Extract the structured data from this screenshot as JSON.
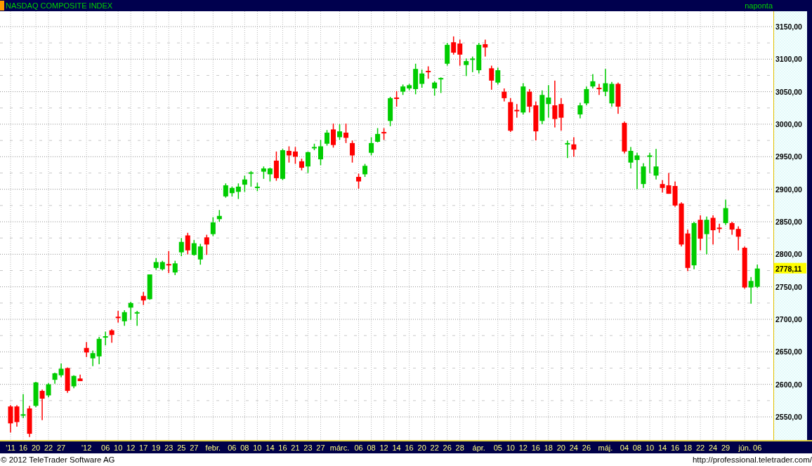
{
  "window": {
    "title": "NASDAQ COMPOSITE INDEX",
    "interval": "naponta"
  },
  "chart": {
    "last_value_label": "2778,11",
    "chart_data": {
      "type": "candlestick",
      "grid": true,
      "ylim": [
        2514.4,
        3173.7
      ],
      "yticks": [
        {
          "value": 3150,
          "label": "3150,00"
        },
        {
          "value": 3100,
          "label": "3100,00"
        },
        {
          "value": 3050,
          "label": "3050,00"
        },
        {
          "value": 3000,
          "label": "3000,00"
        },
        {
          "value": 2950,
          "label": "2950,00"
        },
        {
          "value": 2900,
          "label": "2900,00"
        },
        {
          "value": 2850,
          "label": "2850,00"
        },
        {
          "value": 2800,
          "label": "2800,00"
        },
        {
          "value": 2750,
          "label": "2750,00"
        },
        {
          "value": 2700,
          "label": "2700,00"
        },
        {
          "value": 2650,
          "label": "2650,00"
        },
        {
          "value": 2600,
          "label": "2600,00"
        },
        {
          "value": 2550,
          "label": "2550,00"
        }
      ],
      "categories": [
        "'11",
        null,
        "16",
        null,
        "20",
        null,
        "22",
        null,
        "27",
        null,
        null,
        null,
        "'12",
        null,
        null,
        "06",
        null,
        "10",
        null,
        "12",
        null,
        "17",
        null,
        "19",
        null,
        "23",
        null,
        "25",
        null,
        "27",
        null,
        null,
        "febr.",
        null,
        null,
        "06",
        null,
        "08",
        null,
        "10",
        null,
        "14",
        null,
        "16",
        null,
        "21",
        null,
        "23",
        null,
        "27",
        null,
        null,
        "márc.",
        null,
        null,
        "06",
        null,
        "08",
        null,
        "12",
        null,
        "14",
        null,
        "16",
        null,
        "20",
        null,
        "22",
        null,
        "26",
        null,
        "28",
        null,
        null,
        "ápr.",
        null,
        null,
        "05",
        null,
        "10",
        null,
        "12",
        null,
        "16",
        null,
        "18",
        null,
        "20",
        null,
        "24",
        null,
        "26",
        null,
        null,
        "máj.",
        null,
        null,
        "04",
        null,
        "08",
        null,
        "10",
        null,
        "14",
        null,
        "16",
        null,
        "18",
        null,
        "22",
        null,
        "24",
        null,
        "29",
        null,
        null,
        "jún.",
        null,
        "06"
      ],
      "ohlc": [
        [
          2566,
          2568,
          2526,
          2540
        ],
        [
          2566,
          2568,
          2535,
          2542
        ],
        [
          2553,
          2585,
          2548,
          2554
        ],
        [
          2563,
          2567,
          2519,
          2524
        ],
        [
          2567,
          2604,
          2565,
          2603
        ],
        [
          2590,
          2592,
          2545,
          2578
        ],
        [
          2583,
          2602,
          2580,
          2600
        ],
        [
          2607,
          2618,
          2601,
          2617
        ],
        [
          2614,
          2632,
          2611,
          2624
        ],
        [
          2625,
          2626,
          2587,
          2590
        ],
        [
          2597,
          2614,
          2594,
          2613
        ],
        [
          2609,
          2615,
          2605,
          2605
        ],
        [
          2656,
          2665,
          2642,
          2649
        ],
        [
          2640,
          2652,
          2628,
          2648
        ],
        [
          2643,
          2673,
          2631,
          2670
        ],
        [
          2672,
          2681,
          2660,
          2674
        ],
        [
          2683,
          2685,
          2664,
          2676
        ],
        [
          2704,
          2713,
          2695,
          2702
        ],
        [
          2697,
          2714,
          2690,
          2711
        ],
        [
          2718,
          2727,
          2699,
          2725
        ],
        [
          2709,
          2713,
          2690,
          2711
        ],
        [
          2736,
          2742,
          2722,
          2729
        ],
        [
          2731,
          2769,
          2730,
          2769
        ],
        [
          2779,
          2794,
          2776,
          2788
        ],
        [
          2777,
          2790,
          2775,
          2788
        ],
        [
          2785,
          2805,
          2771,
          2784
        ],
        [
          2772,
          2790,
          2768,
          2786
        ],
        [
          2803,
          2825,
          2797,
          2819
        ],
        [
          2829,
          2833,
          2800,
          2806
        ],
        [
          2799,
          2822,
          2798,
          2817
        ],
        [
          2792,
          2816,
          2784,
          2812
        ],
        [
          2826,
          2830,
          2799,
          2815
        ],
        [
          2831,
          2857,
          2828,
          2849
        ],
        [
          2854,
          2868,
          2850,
          2859
        ],
        [
          2889,
          2909,
          2887,
          2906
        ],
        [
          2894,
          2904,
          2889,
          2902
        ],
        [
          2896,
          2909,
          2885,
          2904
        ],
        [
          2907,
          2921,
          2896,
          2915
        ],
        [
          2924,
          2928,
          2904,
          2926
        ],
        [
          2902,
          2910,
          2897,
          2904
        ],
        [
          2927,
          2935,
          2916,
          2932
        ],
        [
          2923,
          2933,
          2912,
          2932
        ],
        [
          2944,
          2958,
          2913,
          2917
        ],
        [
          2916,
          2962,
          2914,
          2960
        ],
        [
          2959,
          2966,
          2941,
          2952
        ],
        [
          2958,
          2965,
          2939,
          2950
        ],
        [
          2943,
          2947,
          2929,
          2933
        ],
        [
          2935,
          2958,
          2925,
          2957
        ],
        [
          2963,
          2970,
          2960,
          2965
        ],
        [
          2946,
          2976,
          2937,
          2966
        ],
        [
          2970,
          2991,
          2967,
          2987
        ],
        [
          2992,
          3001,
          2964,
          2968
        ],
        [
          2980,
          3000,
          2976,
          2989
        ],
        [
          2987,
          3001,
          2971,
          2979
        ],
        [
          2971,
          2975,
          2941,
          2952
        ],
        [
          2919,
          2924,
          2901,
          2912
        ],
        [
          2923,
          2939,
          2919,
          2936
        ],
        [
          2956,
          2980,
          2952,
          2971
        ],
        [
          2973,
          2994,
          2972,
          2985
        ],
        [
          2988,
          2994,
          2976,
          2986
        ],
        [
          3005,
          3042,
          2997,
          3040
        ],
        [
          3041,
          3051,
          3027,
          3039
        ],
        [
          3050,
          3061,
          3045,
          3058
        ],
        [
          3055,
          3062,
          3052,
          3060
        ],
        [
          3054,
          3093,
          3046,
          3085
        ],
        [
          3062,
          3084,
          3056,
          3078
        ],
        [
          3082,
          3089,
          3070,
          3080
        ],
        [
          3055,
          3066,
          3044,
          3064
        ],
        [
          3069,
          3072,
          3048,
          3071
        ],
        [
          3093,
          3125,
          3090,
          3122
        ],
        [
          3126,
          3135,
          3107,
          3110
        ],
        [
          3124,
          3130,
          3090,
          3107
        ],
        [
          3091,
          3101,
          3074,
          3097
        ],
        [
          3099,
          3104,
          3080,
          3101
        ],
        [
          3083,
          3125,
          3078,
          3122
        ],
        [
          3123,
          3130,
          3104,
          3118
        ],
        [
          3086,
          3090,
          3053,
          3067
        ],
        [
          3064,
          3087,
          3061,
          3083
        ],
        [
          3050,
          3055,
          3035,
          3040
        ],
        [
          3034,
          3040,
          2988,
          2990
        ],
        [
          3022,
          3031,
          3010,
          3020
        ],
        [
          3018,
          3063,
          3015,
          3058
        ],
        [
          3050,
          3054,
          3018,
          3027
        ],
        [
          3029,
          3035,
          2975,
          2989
        ],
        [
          3005,
          3052,
          3000,
          3045
        ],
        [
          3031,
          3060,
          3010,
          3041
        ],
        [
          3029,
          3067,
          2995,
          3008
        ],
        [
          3031,
          3040,
          2990,
          3010
        ],
        [
          2969,
          2975,
          2948,
          2971
        ],
        [
          2969,
          2980,
          2950,
          2961
        ],
        [
          3015,
          3033,
          3009,
          3029
        ],
        [
          3032,
          3058,
          3029,
          3054
        ],
        [
          3058,
          3077,
          3055,
          3066
        ],
        [
          3056,
          3062,
          3045,
          3054
        ],
        [
          3050,
          3085,
          3043,
          3063
        ],
        [
          3032,
          3065,
          3027,
          3062
        ],
        [
          3062,
          3064,
          3016,
          3027
        ],
        [
          3002,
          3004,
          2955,
          2958
        ],
        [
          2941,
          2965,
          2932,
          2959
        ],
        [
          2945,
          2956,
          2900,
          2952
        ],
        [
          2908,
          2940,
          2902,
          2935
        ],
        [
          2950,
          2956,
          2925,
          2952
        ],
        [
          2921,
          2962,
          2915,
          2935
        ],
        [
          2908,
          2914,
          2895,
          2902
        ],
        [
          2906,
          2925,
          2893,
          2893
        ],
        [
          2905,
          2912,
          2873,
          2875
        ],
        [
          2878,
          2880,
          2812,
          2815
        ],
        [
          2832,
          2838,
          2774,
          2779
        ],
        [
          2783,
          2850,
          2777,
          2848
        ],
        [
          2853,
          2860,
          2806,
          2824
        ],
        [
          2831,
          2858,
          2800,
          2853
        ],
        [
          2856,
          2860,
          2815,
          2837
        ],
        [
          2841,
          2847,
          2833,
          2839
        ],
        [
          2848,
          2884,
          2845,
          2871
        ],
        [
          2848,
          2850,
          2830,
          2838
        ],
        [
          2839,
          2843,
          2806,
          2827
        ],
        [
          2810,
          2812,
          2747,
          2749
        ],
        [
          2749,
          2765,
          2724,
          2759
        ],
        [
          2750,
          2784,
          2748,
          2778.11
        ]
      ]
    }
  },
  "footer": {
    "copyright": "© 2012 TeleTrader Software AG",
    "url": "http://professional.teletrader.com/"
  }
}
